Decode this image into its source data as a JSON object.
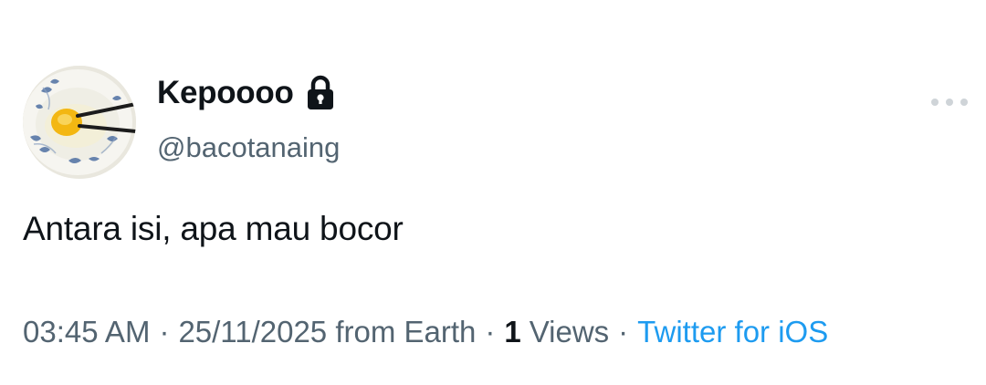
{
  "tweet": {
    "author": {
      "display_name": "Kepoooo",
      "handle": "@bacotanaing",
      "protected_icon": "lock-icon",
      "avatar_icon": "egg-bowl-avatar"
    },
    "more_icon": "more-dots-icon",
    "text": "Antara isi, apa mau bocor",
    "meta": {
      "time": "03:45 AM",
      "separator": "·",
      "date": "25/11/2025",
      "location": " from Earth",
      "views_count": "1",
      "views_label": "Views",
      "source": "Twitter for iOS"
    }
  },
  "colors": {
    "text_primary": "#0f1419",
    "text_secondary": "#536471",
    "link": "#1d9bf0",
    "more_dots": "#cfd4d8"
  }
}
